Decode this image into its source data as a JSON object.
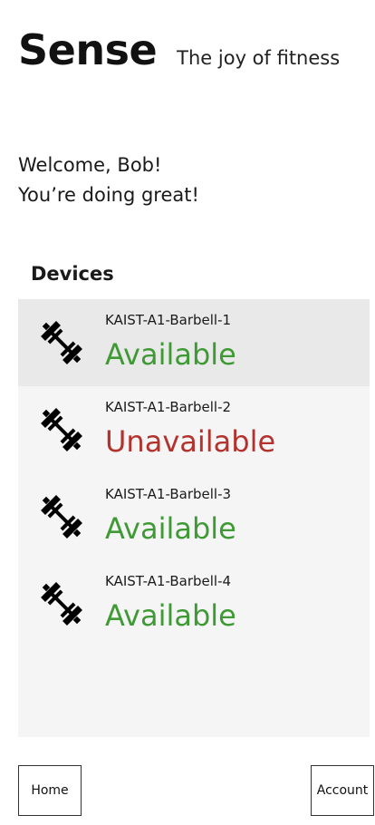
{
  "header": {
    "title": "Sense",
    "tagline": "The joy of fitness"
  },
  "welcome": {
    "line1": "Welcome, Bob!",
    "line2": "You’re doing great!"
  },
  "devices": {
    "heading": "Devices",
    "items": [
      {
        "name": "KAIST-A1-Barbell-1",
        "status": "Available",
        "icon": "barbell-icon",
        "status_color": "#3f9a35",
        "selected": true
      },
      {
        "name": "KAIST-A1-Barbell-2",
        "status": "Unavailable",
        "icon": "barbell-icon",
        "status_color": "#b4322e",
        "selected": false
      },
      {
        "name": "KAIST-A1-Barbell-3",
        "status": "Available",
        "icon": "barbell-icon",
        "status_color": "#3f9a35",
        "selected": false
      },
      {
        "name": "KAIST-A1-Barbell-4",
        "status": "Available",
        "icon": "barbell-icon",
        "status_color": "#3f9a35",
        "selected": false
      }
    ]
  },
  "nav": {
    "home_label": "Home",
    "account_label": "Account"
  },
  "colors": {
    "available": "#3f9a35",
    "unavailable": "#b4322e",
    "list_background": "#f5f5f5",
    "selected_background": "#e9e9e9"
  }
}
